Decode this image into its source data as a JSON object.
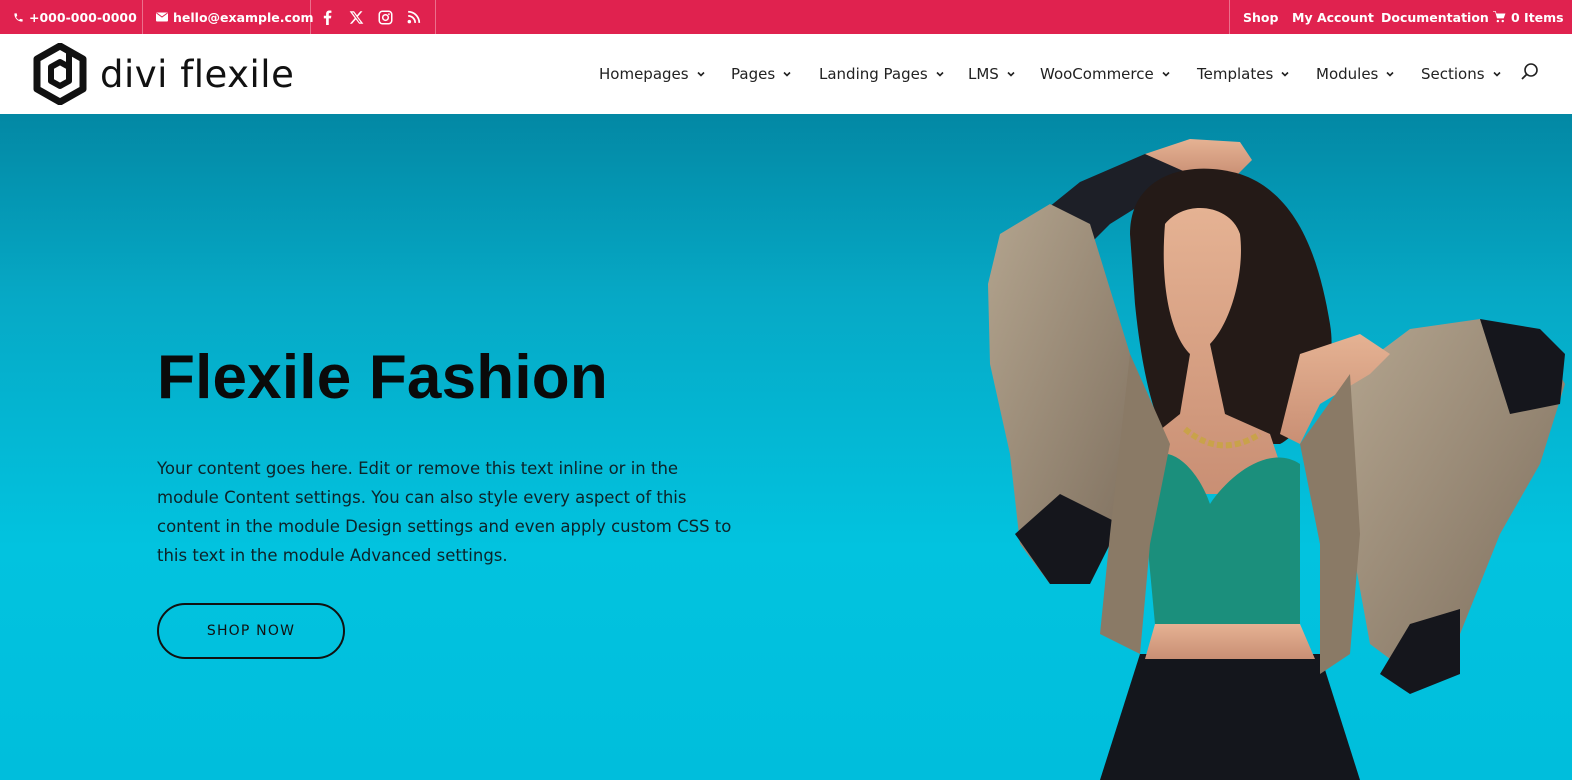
{
  "topbar": {
    "phone": "+000-000-0000",
    "email": "hello@example.com",
    "social_icons": [
      "facebook-icon",
      "x-twitter-icon",
      "instagram-icon",
      "rss-icon"
    ],
    "links": [
      "Shop",
      "My Account",
      "Documentation"
    ],
    "cart_label": "0 Items",
    "bg_color": "#e0224f"
  },
  "header": {
    "logo_text": "divi flexile",
    "nav": [
      {
        "label": "Homepages"
      },
      {
        "label": "Pages"
      },
      {
        "label": "Landing Pages"
      },
      {
        "label": "LMS"
      },
      {
        "label": "WooCommerce"
      },
      {
        "label": "Templates"
      },
      {
        "label": "Modules"
      },
      {
        "label": "Sections"
      }
    ]
  },
  "hero": {
    "title": "Flexile Fashion",
    "body": "Your content goes here. Edit or remove this text inline or in the module Content settings. You can also style every aspect of this content in the module Design settings and even apply custom CSS to this text in the module Advanced settings.",
    "cta": "SHOP NOW",
    "bg_color": "#02c3df"
  }
}
